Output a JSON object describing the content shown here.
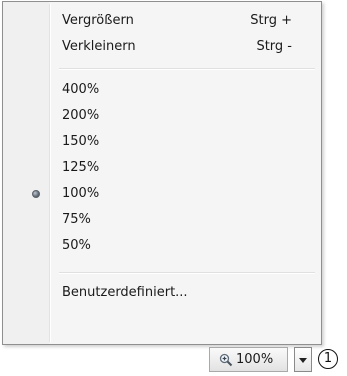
{
  "zoom_menu": {
    "items_top": [
      {
        "label": "Vergrößern",
        "shortcut": "Strg +"
      },
      {
        "label": "Verkleinern",
        "shortcut": "Strg -"
      }
    ],
    "levels": [
      {
        "label": "400%",
        "selected": false
      },
      {
        "label": "200%",
        "selected": false
      },
      {
        "label": "150%",
        "selected": false
      },
      {
        "label": "125%",
        "selected": false
      },
      {
        "label": "100%",
        "selected": true
      },
      {
        "label": "75%",
        "selected": false
      },
      {
        "label": "50%",
        "selected": false
      }
    ],
    "custom_label": "Benutzerdefiniert..."
  },
  "status_bar": {
    "zoom_value": "100%",
    "zoom_icon": "magnifier-icon",
    "dropdown_icon": "chevron-down-icon"
  },
  "callout": {
    "number": "1"
  },
  "colors": {
    "menu_background": "#f5f5f5",
    "menu_border": "#8f8f8f",
    "text": "#1a1a1a"
  }
}
